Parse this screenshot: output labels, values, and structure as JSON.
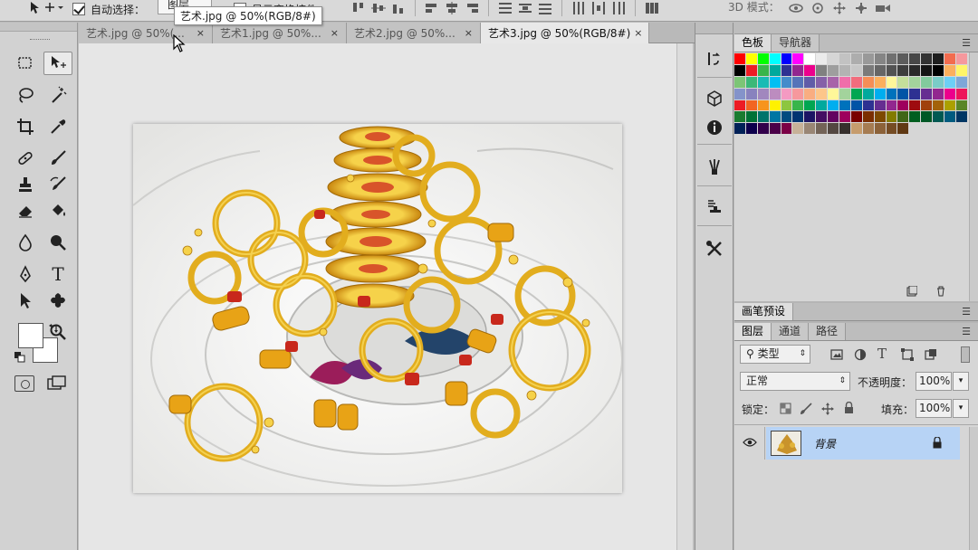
{
  "options_bar": {
    "auto_select_label": "自动选择：",
    "auto_select_checked": true,
    "auto_select_target": "图层",
    "show_transform_label": "显示变换控件",
    "mode_3d_label": "3D 模式："
  },
  "tooltip": {
    "text": "艺术.jpg @ 50%(RGB/8#)"
  },
  "tabs": [
    {
      "label": "艺术.jpg @ 50%(...",
      "close": "×",
      "active": false
    },
    {
      "label": "艺术1.jpg @ 50%...",
      "close": "×",
      "active": false
    },
    {
      "label": "艺术2.jpg @ 50%...",
      "close": "×",
      "active": false
    },
    {
      "label": "艺术3.jpg @ 50%(RGB/8#)",
      "close": "×",
      "active": true
    }
  ],
  "toolbar": {
    "tools": [
      {
        "name": "rectangular-marquee-tool",
        "icon": "marquee-icon",
        "active": false
      },
      {
        "name": "move-tool",
        "icon": "move-icon",
        "active": true
      },
      {
        "name": "lasso-tool",
        "icon": "lasso-icon",
        "active": false
      },
      {
        "name": "magic-wand-tool",
        "icon": "magic-wand-icon",
        "active": false
      },
      {
        "name": "crop-tool",
        "icon": "crop-icon",
        "active": false
      },
      {
        "name": "eyedropper-tool",
        "icon": "eyedropper-icon",
        "active": false
      },
      {
        "name": "healing-brush-tool",
        "icon": "bandage-icon",
        "active": false
      },
      {
        "name": "brush-tool",
        "icon": "brush-icon",
        "active": false
      },
      {
        "name": "clone-stamp-tool",
        "icon": "stamp-icon",
        "active": false
      },
      {
        "name": "history-brush-tool",
        "icon": "history-brush-icon",
        "active": false
      },
      {
        "name": "eraser-tool",
        "icon": "eraser-icon",
        "active": false
      },
      {
        "name": "paint-bucket-tool",
        "icon": "paint-bucket-icon",
        "active": false
      },
      {
        "name": "blur-tool",
        "icon": "droplet-icon",
        "active": false
      },
      {
        "name": "dodge-tool",
        "icon": "dodge-icon",
        "active": false
      },
      {
        "name": "pen-tool",
        "icon": "pen-icon",
        "active": false
      },
      {
        "name": "type-tool",
        "icon": "type-icon",
        "active": false
      },
      {
        "name": "path-selection-tool",
        "icon": "arrow-icon",
        "active": false
      },
      {
        "name": "custom-shape-tool",
        "icon": "shape-icon",
        "active": false
      },
      {
        "name": "hand-tool",
        "icon": "hand-icon",
        "active": false
      },
      {
        "name": "zoom-tool",
        "icon": "zoom-icon",
        "active": false
      }
    ],
    "type_glyph": "T",
    "foreground_color": "#ffffff",
    "background_color": "#ffffff"
  },
  "swatches_panel": {
    "tabs": [
      "色板",
      "导航器"
    ],
    "active_tab": "色板",
    "colors": [
      "#ff0000",
      "#ffff00",
      "#00ff00",
      "#00ffff",
      "#0000ff",
      "#ff00ff",
      "#ffffff",
      "#ebebeb",
      "#d6d6d6",
      "#c2c2c2",
      "#adadad",
      "#999999",
      "#858585",
      "#707070",
      "#5c5c5c",
      "#474747",
      "#333333",
      "#1f1f1f",
      "#f26c4f",
      "#f5989d",
      "#000000",
      "#ed1c24",
      "#39b54a",
      "#00a99d",
      "#2e3192",
      "#92278f",
      "#ec008c",
      "#808080",
      "#9e9e9e",
      "#b3b3b3",
      "#c7c7c7",
      "#7a7a7a",
      "#666666",
      "#525252",
      "#3d3d3d",
      "#292929",
      "#141414",
      "#000000",
      "#fbaf5d",
      "#fff568",
      "#7cc576",
      "#3bb878",
      "#1abbb4",
      "#00bff3",
      "#448ccb",
      "#5574b9",
      "#605ca8",
      "#8560a8",
      "#a763a9",
      "#f06eaa",
      "#f26d7d",
      "#f68e56",
      "#fbaf5d",
      "#fff79a",
      "#c4df9b",
      "#a3d39c",
      "#82ca9d",
      "#7accc8",
      "#6dcff6",
      "#7ea7d8",
      "#8493ca",
      "#8882be",
      "#a187be",
      "#bc8cbf",
      "#f49ac2",
      "#f6989d",
      "#f9ad81",
      "#fdc68a",
      "#fff799",
      "#a3d39c",
      "#00a651",
      "#00a99d",
      "#00aeef",
      "#0072bc",
      "#0054a6",
      "#2e3192",
      "#662d91",
      "#92278f",
      "#ec008c",
      "#ed145b",
      "#ed1c24",
      "#f26522",
      "#f7941d",
      "#fff200",
      "#8dc63f",
      "#39b54a",
      "#00a651",
      "#00a99d",
      "#00aeef",
      "#0072bc",
      "#0054a6",
      "#2e3192",
      "#662d91",
      "#92278f",
      "#9e005d",
      "#9e0b0f",
      "#a0410d",
      "#a36209",
      "#aba000",
      "#598527",
      "#1a7b30",
      "#007236",
      "#00746b",
      "#0076a3",
      "#004b80",
      "#003471",
      "#1b1464",
      "#440e62",
      "#630460",
      "#9e005d",
      "#790000",
      "#7b2e00",
      "#7d4900",
      "#827b00",
      "#406618",
      "#005e20",
      "#005826",
      "#005952",
      "#005b7f",
      "#003663",
      "#002157",
      "#0d004c",
      "#32004b",
      "#4b0049",
      "#7b0046",
      "#c7b299",
      "#998675",
      "#736357",
      "#534741",
      "#37302d",
      "#c69c6d",
      "#a67c52",
      "#8c6239",
      "#754c24",
      "#603913"
    ]
  },
  "brush_panel": {
    "title": "画笔预设"
  },
  "layers_panel": {
    "tabs": [
      "图层",
      "通道",
      "路径"
    ],
    "active_tab": "图层",
    "filter_label": "类型",
    "blend_mode": "正常",
    "opacity_label": "不透明度：",
    "opacity_value": "100%",
    "lock_label": "锁定：",
    "fill_label": "填充：",
    "fill_value": "100%",
    "layers": [
      {
        "name": "背景",
        "visible": true,
        "locked": true,
        "selected": true
      }
    ]
  },
  "colors": {
    "accent_selection": "#b7d3f5",
    "panel_bg": "#d6d6d6"
  }
}
